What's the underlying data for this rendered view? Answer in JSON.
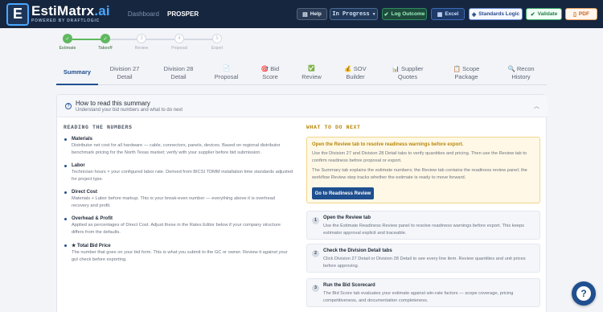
{
  "header": {
    "logo_letter": "E",
    "app_name_main": "EstiMatrx",
    "app_name_suffix": ".ai",
    "tagline": "POWERED BY DRAFTLOGIC",
    "nav_dashboard": "Dashboard",
    "nav_project": "PROSPER",
    "help_label": "Help",
    "status_value": "In Progress",
    "log_label": "Log Outcome",
    "excel_label": "Excel",
    "standards_label": "Standards Logic",
    "validate_label": "Validate",
    "pdf_label": "PDF"
  },
  "stepper": [
    {
      "label": "Estimate",
      "num": "1",
      "state": "done"
    },
    {
      "label": "Takeoff",
      "num": "2",
      "state": "done"
    },
    {
      "label": "Review",
      "num": "3",
      "state": "todo"
    },
    {
      "label": "Proposal",
      "num": "4",
      "state": "todo"
    },
    {
      "label": "Export",
      "num": "5",
      "state": "todo"
    }
  ],
  "tabs": [
    {
      "l1": "Summary",
      "l2": "",
      "icon": ""
    },
    {
      "l1": "Division 27",
      "l2": "Detail",
      "icon": ""
    },
    {
      "l1": "Division 28",
      "l2": "Detail",
      "icon": ""
    },
    {
      "l1": "Proposal",
      "l2": "",
      "icon": "📄"
    },
    {
      "l1": "Bid",
      "l2": "Score",
      "icon": "🎯"
    },
    {
      "l1": "Review",
      "l2": "",
      "icon": "✅"
    },
    {
      "l1": "SOV",
      "l2": "Builder",
      "icon": "💰"
    },
    {
      "l1": "Supplier",
      "l2": "Quotes",
      "icon": "📊"
    },
    {
      "l1": "Scope",
      "l2": "Package",
      "icon": "📋"
    },
    {
      "l1": "Recon",
      "l2": "History",
      "icon": "🔍"
    }
  ],
  "card": {
    "title": "How to read this summary",
    "subtitle": "Understand your bid numbers and what to do next"
  },
  "left": {
    "title": "READING THE NUMBERS",
    "items": [
      {
        "heading": "Materials",
        "body": "Distributor net cost for all hardware — cable, connectors, panels, devices. Based on regional distributor benchmark pricing for the North Texas market; verify with your supplier before bid submission."
      },
      {
        "heading": "Labor",
        "body": "Technician hours × your configured labor rate. Derived from BICSI TDMM installation time standards adjusted for project type."
      },
      {
        "heading": "Direct Cost",
        "body": "Materials + Labor before markup. This is your break-even number — everything above it is overhead recovery and profit."
      },
      {
        "heading": "Overhead & Profit",
        "body": "Applied as percentages of Direct Cost. Adjust these in the Rates Editor below if your company structure differs from the defaults."
      },
      {
        "heading": "★ Total Bid Price",
        "body": "The number that goes on your bid form. This is what you submit to the GC or owner. Review it against your gut check before exporting."
      }
    ]
  },
  "right": {
    "title": "WHAT TO DO NEXT",
    "alert_heading": "Open the Review tab to resolve readiness warnings before export.",
    "alert_p1": "Use the Division 27 and Division 28 Detail tabs to verify quantities and pricing. Then use the Review tab to confirm readiness before proposal or export.",
    "alert_p2": "The Summary tab explains the estimate numbers; the Review tab contains the readiness review panel; the workflow Review step tracks whether the estimate is ready to move forward.",
    "button": "Go to Readiness Review",
    "steps": [
      {
        "num": "1",
        "heading": "Open the Review tab",
        "body": "Use the Estimate Readiness Review panel to resolve readiness warnings before export. This keeps estimator approval explicit and traceable."
      },
      {
        "num": "2",
        "heading": "Check the Division Detail tabs",
        "body": "Click Division 27 Detail or Division 28 Detail to see every line item. Review quantities and unit prices before approving."
      },
      {
        "num": "3",
        "heading": "Run the Bid Scorecard",
        "body": "The Bid Score tab evaluates your estimate against win-rate factors — scope coverage, pricing competitiveness, and documentation completeness."
      }
    ]
  },
  "fab_label": "?"
}
